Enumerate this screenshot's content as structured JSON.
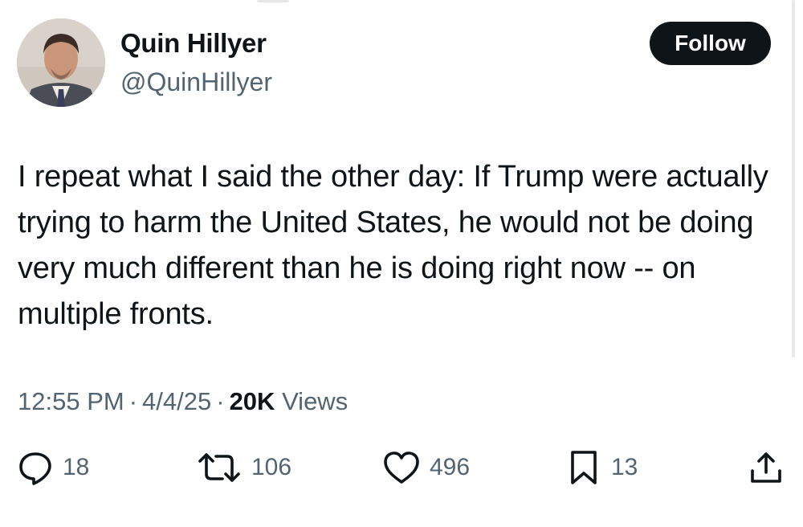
{
  "author": {
    "display_name": "Quin Hillyer",
    "handle": "@QuinHillyer"
  },
  "follow_button": {
    "label": "Follow"
  },
  "tweet": {
    "text": "I repeat what I said the other day: If Trump were actually trying to harm the United States, he would not be doing very much different than he is doing right now -- on multiple fronts."
  },
  "meta": {
    "time": "12:55 PM",
    "date": "4/4/25",
    "separator": "·",
    "views_count": "20K",
    "views_label": "Views"
  },
  "actions": {
    "replies": {
      "icon": "reply-icon",
      "count": "18"
    },
    "reposts": {
      "icon": "repost-icon",
      "count": "106"
    },
    "likes": {
      "icon": "heart-icon",
      "count": "496"
    },
    "bookmarks": {
      "icon": "bookmark-icon",
      "count": "13"
    },
    "share": {
      "icon": "share-icon"
    }
  },
  "colors": {
    "text_primary": "#0f1419",
    "text_secondary": "#536471",
    "button_bg": "#0f1419",
    "button_text": "#ffffff"
  }
}
